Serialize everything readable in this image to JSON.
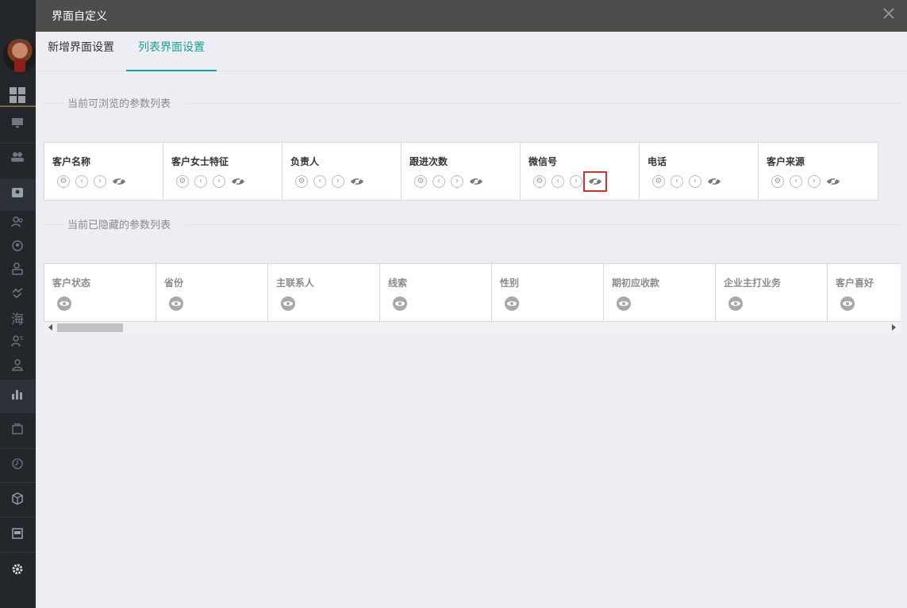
{
  "modal": {
    "title": "界面自定义",
    "close_icon": "close-icon"
  },
  "tabs": [
    {
      "label": "新增界面设置",
      "active": false
    },
    {
      "label": "列表界面设置",
      "active": true
    }
  ],
  "visible_section": {
    "title": "当前可浏览的参数列表",
    "fields": [
      {
        "name": "客户名称"
      },
      {
        "name": "客户女士特征"
      },
      {
        "name": "负责人"
      },
      {
        "name": "跟进次数"
      },
      {
        "name": "微信号",
        "highlighted_action": "hide"
      },
      {
        "name": "电话"
      },
      {
        "name": "客户来源"
      }
    ],
    "action_icons": [
      "gear-icon",
      "chevron-left-icon",
      "chevron-right-icon",
      "eye-slash-icon"
    ]
  },
  "hidden_section": {
    "title": "当前已隐藏的参数列表",
    "fields": [
      {
        "name": "客户状态"
      },
      {
        "name": "省份"
      },
      {
        "name": "主联系人"
      },
      {
        "name": "线索"
      },
      {
        "name": "性别"
      },
      {
        "name": "期初应收款"
      },
      {
        "name": "企业主打业务"
      },
      {
        "name": "客户喜好"
      }
    ],
    "action_icon": "eye-icon"
  },
  "sidebar": {
    "text_item": "海",
    "icons": [
      "avatar",
      "grid-icon",
      "monitor-icon",
      "users-icon",
      "contact-icon",
      "user-group-icon",
      "globe-icon",
      "user-card-icon",
      "handshake-icon",
      "sea-icon",
      "user-list-icon",
      "user-icon",
      "bar-chart-icon",
      "box-stack-icon",
      "clock-icon",
      "cube-icon",
      "report-icon",
      "gear-icon"
    ]
  },
  "colors": {
    "accent": "#1aa094",
    "highlight_box": "#e02b2b",
    "header_bg": "#4d4d4d"
  }
}
